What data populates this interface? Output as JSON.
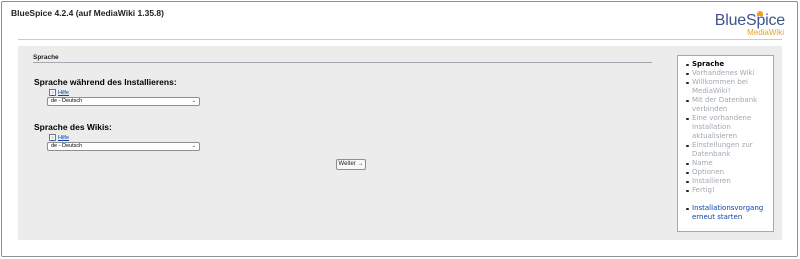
{
  "header": {
    "title": "BlueSpice 4.2.4 (auf MediaWiki 1.35.8)",
    "logo": {
      "main": "BlueSpice",
      "sub": "MediaWiki"
    }
  },
  "section": {
    "legend": "Sprache"
  },
  "fields": [
    {
      "label": "Sprache während des Installierens:",
      "help": "Hilfe",
      "value": "de - Deutsch"
    },
    {
      "label": "Sprache des Wikis:",
      "help": "Hilfe",
      "value": "de - Deutsch"
    }
  ],
  "next_button": "Weiter →",
  "steps": {
    "items": [
      "Sprache",
      "Vorhandenes Wiki",
      "Willkommen bei MediaWiki!",
      "Mit der Datenbank verbinden",
      "Eine vorhandene Installation aktualisieren",
      "Einstellungen zur Datenbank",
      "Name",
      "Optionen",
      "Installieren",
      "Fertig!"
    ],
    "restart": "Installationsvorgang erneut starten"
  },
  "colors": {
    "accent_link": "#0645ad",
    "logo_blue": "#3e5389",
    "logo_orange": "#f4a014"
  },
  "icons": {
    "help": "help-icon",
    "dropdown": "chevron-down-icon"
  }
}
